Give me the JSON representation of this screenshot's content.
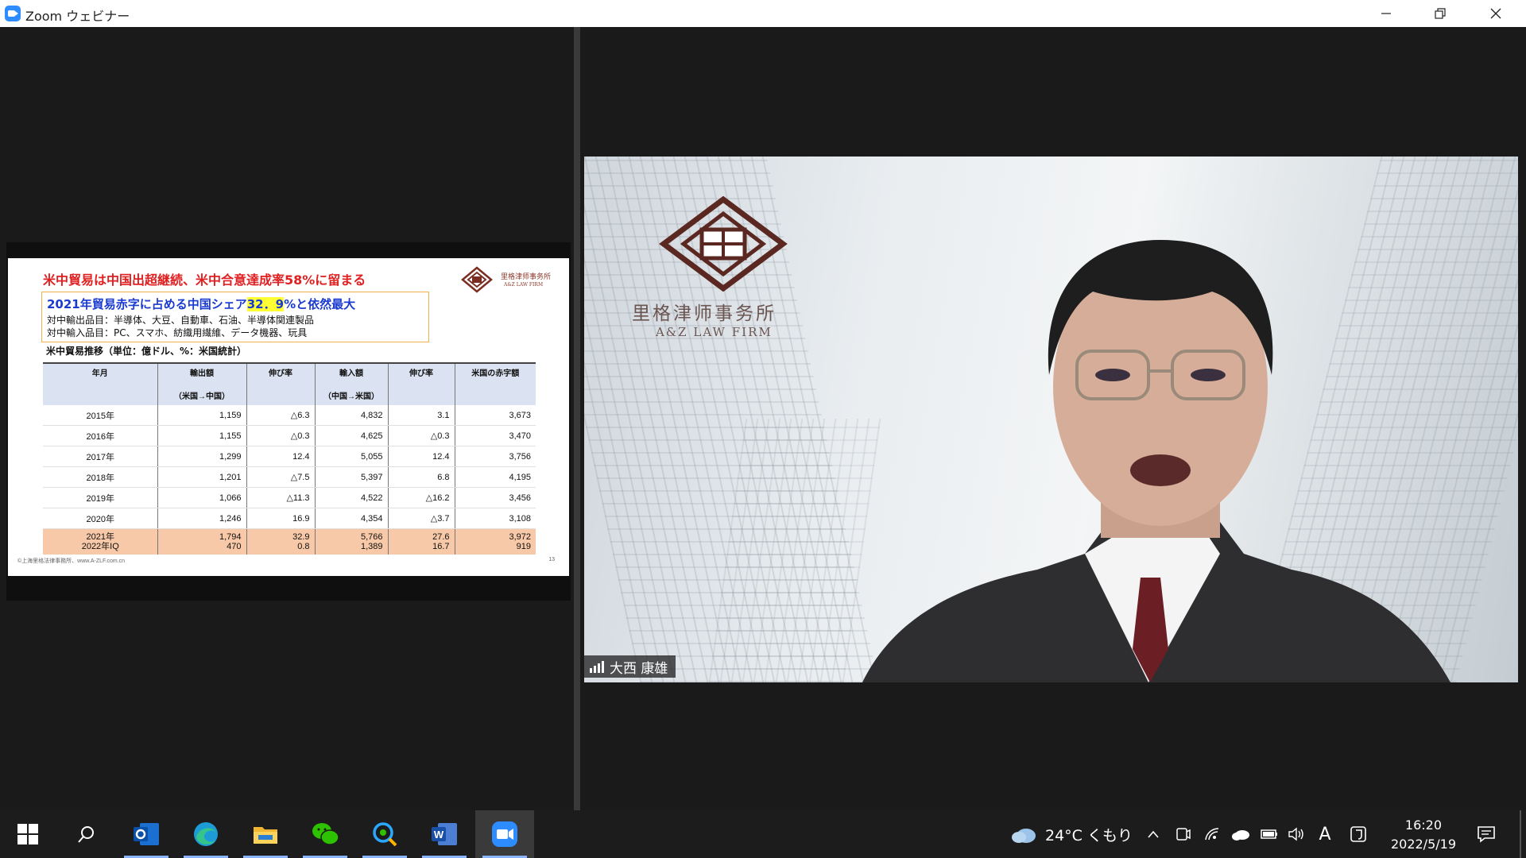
{
  "window": {
    "title": "Zoom ウェビナー",
    "controls": [
      "minimize",
      "restore",
      "close"
    ]
  },
  "slide": {
    "headline": "米中貿易は中国出超継続、米中合意達成率58%に留まる",
    "logo_name": "里格津师事务所",
    "logo_en": "A&Z LAW FIRM",
    "callout": {
      "line1_prefix": "2021年貿易赤字に占める中国シェア",
      "line1_highlight": "32．9",
      "line1_suffix": "%と依然最大",
      "line2": "対中輸出品目：半導体、大豆、自動車、石油、半導体関連製品",
      "line3": "対中輸入品目：PC、スマホ、紡織用繊維、データ機器、玩具"
    },
    "table_title": "米中貿易推移（単位：億ドル、%：米国統計）",
    "table": {
      "headers": [
        {
          "main": "年月",
          "sub": ""
        },
        {
          "main": "輸出額",
          "sub": "（米国→中国）"
        },
        {
          "main": "伸び率",
          "sub": ""
        },
        {
          "main": "輸入額",
          "sub": "（中国→米国）"
        },
        {
          "main": "伸び率",
          "sub": ""
        },
        {
          "main": "米国の赤字額",
          "sub": ""
        }
      ],
      "rows": [
        [
          "2015年",
          "1,159",
          "△6.3",
          "4,832",
          "3.1",
          "3,673"
        ],
        [
          "2016年",
          "1,155",
          "△0.3",
          "4,625",
          "△0.3",
          "3,470"
        ],
        [
          "2017年",
          "1,299",
          "12.4",
          "5,055",
          "12.4",
          "3,756"
        ],
        [
          "2018年",
          "1,201",
          "△7.5",
          "5,397",
          "6.8",
          "4,195"
        ],
        [
          "2019年",
          "1,066",
          "△11.3",
          "4,522",
          "△16.2",
          "3,456"
        ],
        [
          "2020年",
          "1,246",
          "16.9",
          "4,354",
          "△3.7",
          "3,108"
        ]
      ],
      "highlight_rows": [
        [
          "2021年",
          "1,794",
          "32.9",
          "5,766",
          "27.6",
          "3,972"
        ],
        [
          "2022年IQ",
          "470",
          "0.8",
          "1,389",
          "16.7",
          "919"
        ]
      ]
    },
    "footer": "©上海里格法律事務所、www.A-ZLF.com.cn",
    "page_number": "13"
  },
  "video": {
    "firm_name": "里格津师事务所",
    "firm_en": "A&Z LAW FIRM",
    "participant_name": "大西 康雄"
  },
  "taskbar": {
    "apps": [
      "start",
      "search",
      "outlook",
      "edge",
      "file-explorer",
      "wechat",
      "chat",
      "word",
      "zoom"
    ],
    "active_app": "zoom",
    "weather": "24°C くもり",
    "ime": "A",
    "time": "16:20",
    "date": "2022/5/19"
  }
}
